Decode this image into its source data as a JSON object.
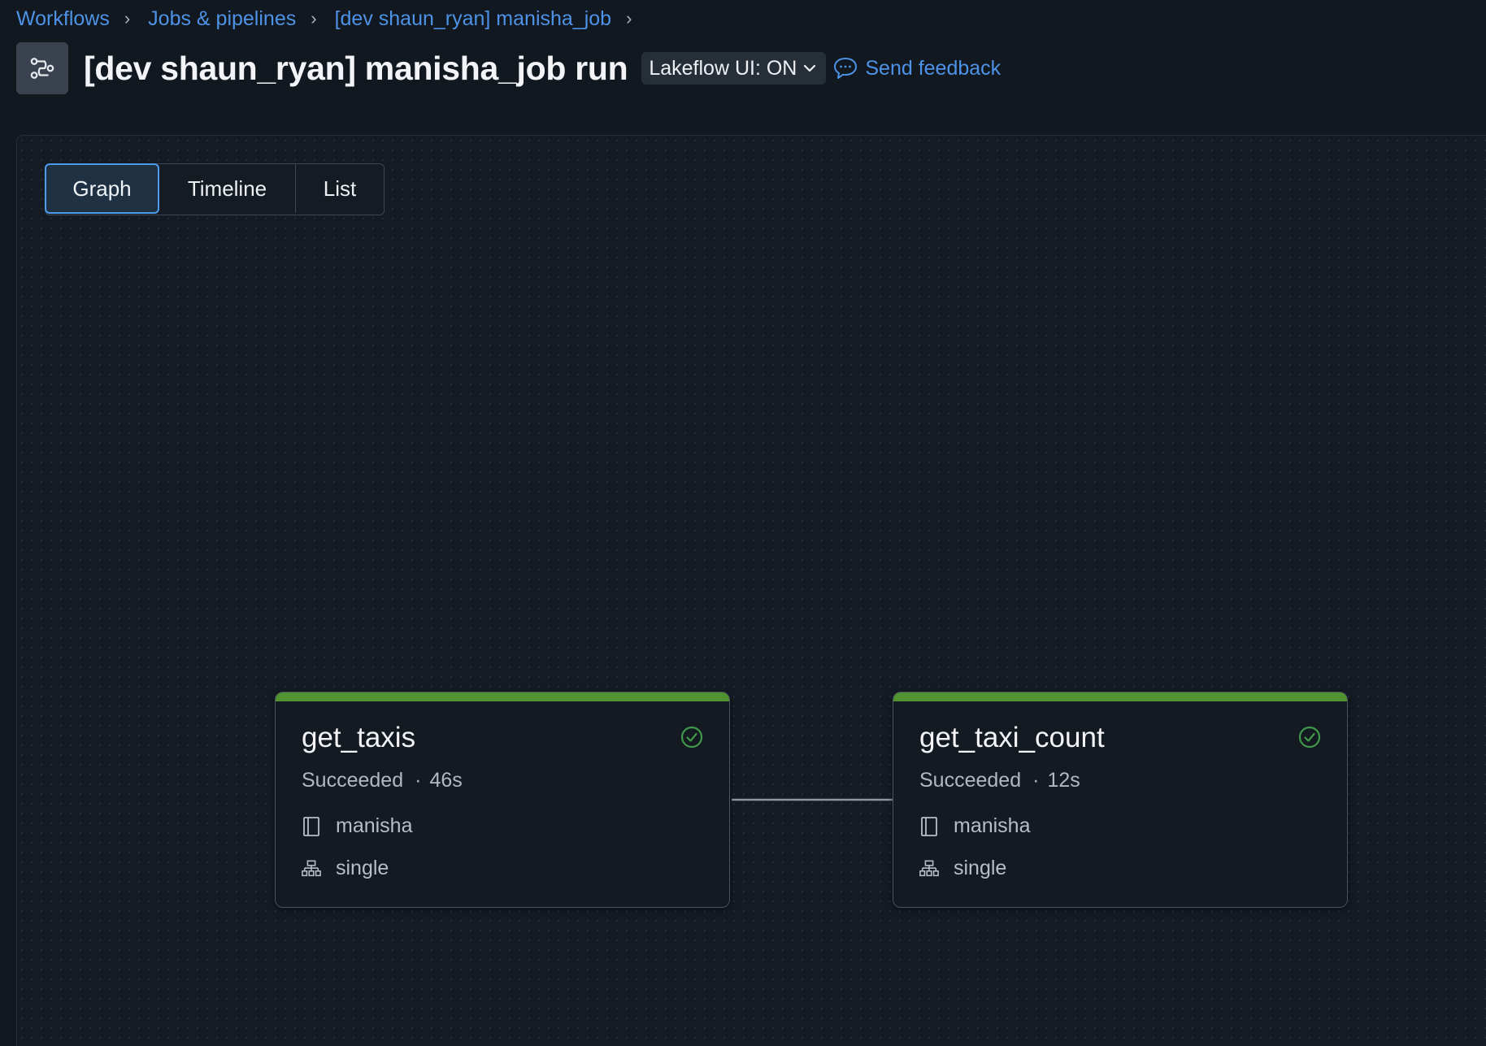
{
  "breadcrumb": {
    "items": [
      "Workflows",
      "Jobs & pipelines",
      "[dev shaun_ryan] manisha_job"
    ]
  },
  "header": {
    "title": "[dev shaun_ryan] manisha_job run",
    "lakeflow_toggle": "Lakeflow UI: ON",
    "feedback_label": "Send feedback"
  },
  "view_tabs": {
    "graph": "Graph",
    "timeline": "Timeline",
    "list": "List",
    "selected": "Graph"
  },
  "tasks": [
    {
      "name": "get_taxis",
      "status": "Succeeded",
      "duration": "46s",
      "notebook": "manisha",
      "cluster": "single"
    },
    {
      "name": "get_taxi_count",
      "status": "Succeeded",
      "duration": "12s",
      "notebook": "manisha",
      "cluster": "single"
    }
  ],
  "colors": {
    "accent": "#4d92e6",
    "success": "#519231",
    "background": "#121820"
  },
  "icons": {
    "header": "workflow-icon",
    "lakeflow": "chevron-down-icon",
    "feedback": "speech-bubble-icon",
    "task_status": "check-circle-icon",
    "task_notebook": "notebook-icon",
    "task_cluster": "cluster-icon"
  }
}
